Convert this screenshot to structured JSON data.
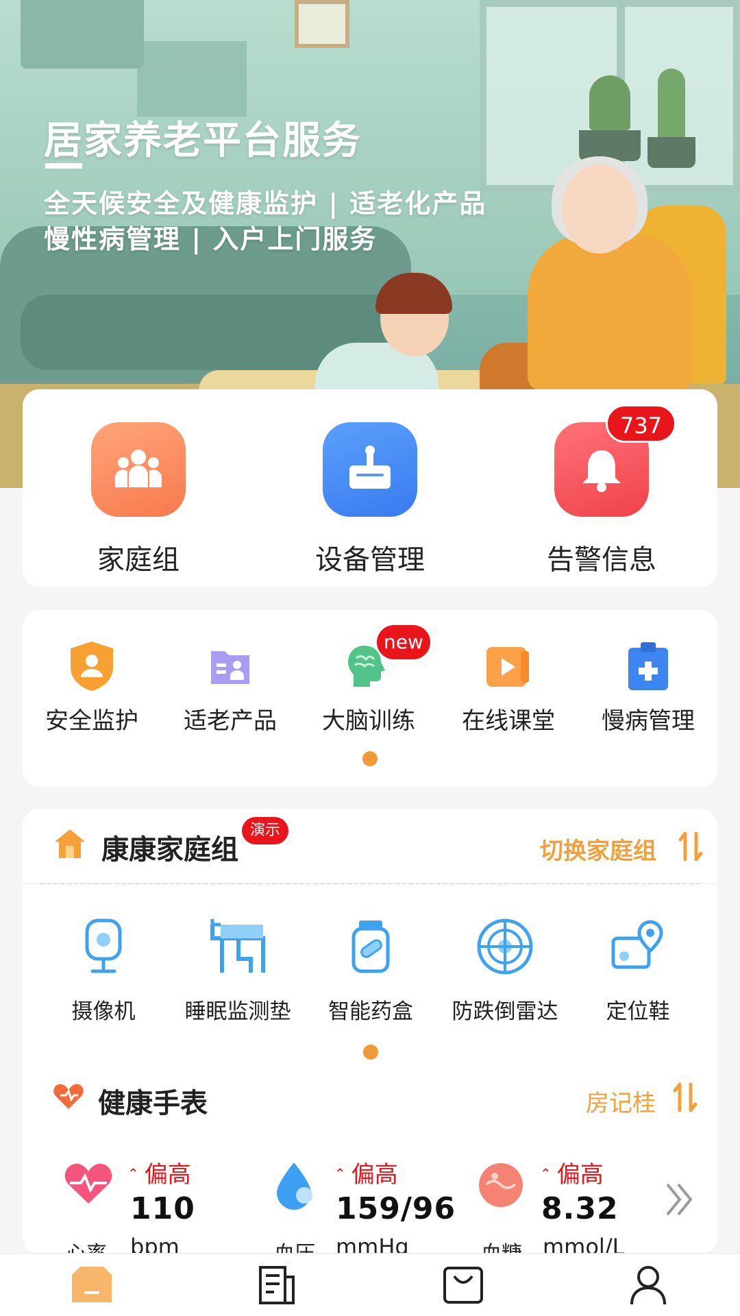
{
  "banner": {
    "title": "居家养老平台服务",
    "line1": "全天候安全及健康监护 | 适老化产品",
    "line2": "慢性病管理 | 入户上门服务"
  },
  "top_actions": [
    {
      "label": "家庭组",
      "icon": "family-icon",
      "color": "#fb8a5c"
    },
    {
      "label": "设备管理",
      "icon": "device-box-icon",
      "color": "#4a8cf5"
    },
    {
      "label": "告警信息",
      "icon": "bell-icon",
      "color": "#f7555c",
      "badge": "737"
    }
  ],
  "services": [
    {
      "label": "安全监护",
      "icon": "shield-user-icon"
    },
    {
      "label": "适老产品",
      "icon": "product-folder-icon"
    },
    {
      "label": "大脑训练",
      "icon": "brain-icon",
      "badge": "new"
    },
    {
      "label": "在线课堂",
      "icon": "video-play-icon"
    },
    {
      "label": "慢病管理",
      "icon": "medical-kit-icon"
    }
  ],
  "group": {
    "name": "康康家庭组",
    "badge": "演示",
    "switch_label": "切换家庭组"
  },
  "devices": [
    {
      "label": "摄像机",
      "icon": "camera-icon"
    },
    {
      "label": "睡眠监测垫",
      "icon": "sleep-bed-icon"
    },
    {
      "label": "智能药盒",
      "icon": "pill-bottle-icon"
    },
    {
      "label": "防跌倒雷达",
      "icon": "radar-icon"
    },
    {
      "label": "定位鞋",
      "icon": "location-shoe-icon"
    }
  ],
  "watch": {
    "title": "健康手表",
    "user": "房记桂",
    "metrics": [
      {
        "name": "心率",
        "flag": "偏高",
        "value": "110",
        "unit": "bpm",
        "icon": "heart-rate-icon"
      },
      {
        "name": "血压",
        "flag": "偏高",
        "value": "159/96",
        "unit": "mmHg",
        "icon": "blood-drop-icon"
      },
      {
        "name": "血糖",
        "flag": "偏高",
        "value": "8.32",
        "unit": "mmol/L",
        "icon": "blood-sugar-icon"
      }
    ]
  },
  "nav": [
    {
      "name": "home-icon",
      "active": true
    },
    {
      "name": "news-icon",
      "active": false
    },
    {
      "name": "shop-bag-icon",
      "active": false
    },
    {
      "name": "profile-icon",
      "active": false
    }
  ],
  "colors": {
    "accent": "#f29a38",
    "alert": "#e8151b"
  }
}
